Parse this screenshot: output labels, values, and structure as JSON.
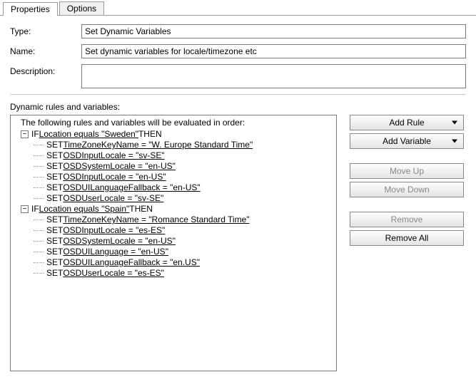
{
  "tabs": {
    "properties": "Properties",
    "options": "Options"
  },
  "form": {
    "type_label": "Type:",
    "type_value": "Set Dynamic Variables",
    "name_label": "Name:",
    "name_value": "Set dynamic variables for locale/timezone etc",
    "desc_label": "Description:",
    "desc_value": ""
  },
  "rules_label": "Dynamic rules and variables:",
  "tree": {
    "intro": "The following rules and variables will be evaluated in order:",
    "groups": [
      {
        "cond_prefix": "IF  ",
        "cond_text": "Location equals \"Sweden\"",
        "cond_suffix": "  THEN",
        "sets": [
          {
            "v": "TimeZoneKeyName = \"W. Europe Standard Time\""
          },
          {
            "v": "OSDInputLocale = \"sv-SE\""
          },
          {
            "v": "OSDSystemLocale = \"en-US\""
          },
          {
            "v": "OSDInputLocale = \"en-US\""
          },
          {
            "v": "OSDUILanguageFallback = \"en-US\""
          },
          {
            "v": "OSDUserLocale = \"sv-SE\""
          }
        ]
      },
      {
        "cond_prefix": "IF  ",
        "cond_text": "Location equals \"Spain\"",
        "cond_suffix": "  THEN",
        "sets": [
          {
            "v": "TimeZoneKeyName = \"Romance Standard Time\""
          },
          {
            "v": "OSDInputLocale = \"es-ES\""
          },
          {
            "v": "OSDSystemLocale = \"en-US\""
          },
          {
            "v": "OSDUILanguage = \"en-US\""
          },
          {
            "v": "OSDUILanguageFallback = \"en.US\""
          },
          {
            "v": "OSDUserLocale = \"es-ES\""
          }
        ]
      }
    ],
    "set_kw": "SET  "
  },
  "buttons": {
    "add_rule": "Add Rule",
    "add_variable": "Add Variable",
    "move_up": "Move Up",
    "move_down": "Move Down",
    "remove": "Remove",
    "remove_all": "Remove All"
  }
}
